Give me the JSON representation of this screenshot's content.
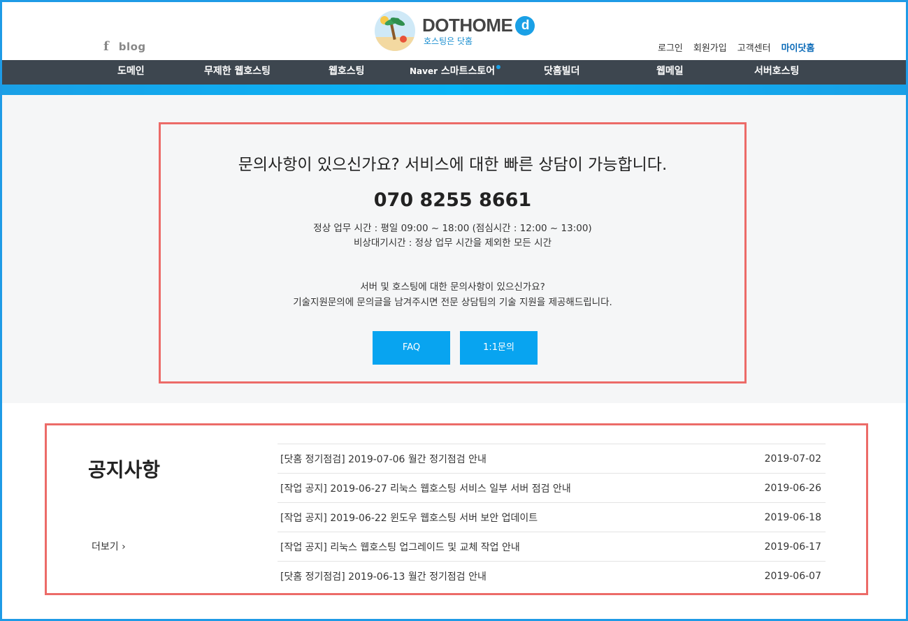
{
  "header": {
    "social": {
      "facebook_icon": "f",
      "blog_label": "blog"
    },
    "logo": {
      "title": "DOTHOME",
      "badge": "d",
      "subtitle": "호스팅은 닷홈"
    },
    "util_nav": [
      "로그인",
      "회원가입",
      "고객센터",
      "마이닷홈"
    ]
  },
  "gnb": {
    "items": [
      {
        "label": "도메인"
      },
      {
        "label": "무제한 웹호스팅"
      },
      {
        "label": "웹호스팅"
      },
      {
        "label_small": "Naver",
        "label": "스마트스토어"
      },
      {
        "label": "닷홈빌더"
      },
      {
        "label": "웹메일"
      },
      {
        "label": "서버호스팅"
      }
    ]
  },
  "consult": {
    "title": "문의사항이 있으신가요? 서비스에 대한 빠른 상담이 가능합니다.",
    "phone": "070 8255 8661",
    "hours_line1": "정상 업무 시간 : 평일 09:00 ~ 18:00 (점심시간 : 12:00 ~ 13:00)",
    "hours_line2": "비상대기시간 : 정상 업무 시간을 제외한 모든 시간",
    "desc_line1": "서버 및 호스팅에 대한 문의사항이 있으신가요?",
    "desc_line2": "기술지원문의에 문의글을 남겨주시면 전문 상담팀의 기술 지원을 제공해드립니다.",
    "faq_label": "FAQ",
    "inquiry_label": "1:1문의"
  },
  "notice": {
    "title": "공지사항",
    "more_label": "더보기 ›",
    "items": [
      {
        "title": "[닷홈 정기점검] 2019-07-06 월간 정기점검 안내",
        "date": "2019-07-02"
      },
      {
        "title": "[작업 공지] 2019-06-27 리눅스 웹호스팅 서비스 일부 서버 점검 안내",
        "date": "2019-06-26"
      },
      {
        "title": "[작업 공지] 2019-06-22 윈도우 웹호스팅 서버 보안 업데이트",
        "date": "2019-06-18"
      },
      {
        "title": "[작업 공지] 리눅스 웹호스팅 업그레이드 및 교체 작업 안내",
        "date": "2019-06-17"
      },
      {
        "title": "[닷홈 정기점검] 2019-06-13 월간 정기점검 안내",
        "date": "2019-06-07"
      }
    ]
  },
  "colors": {
    "brand_blue": "#08a4f0",
    "nav_bg": "#3d464f",
    "highlight_border": "#ec6b68"
  }
}
